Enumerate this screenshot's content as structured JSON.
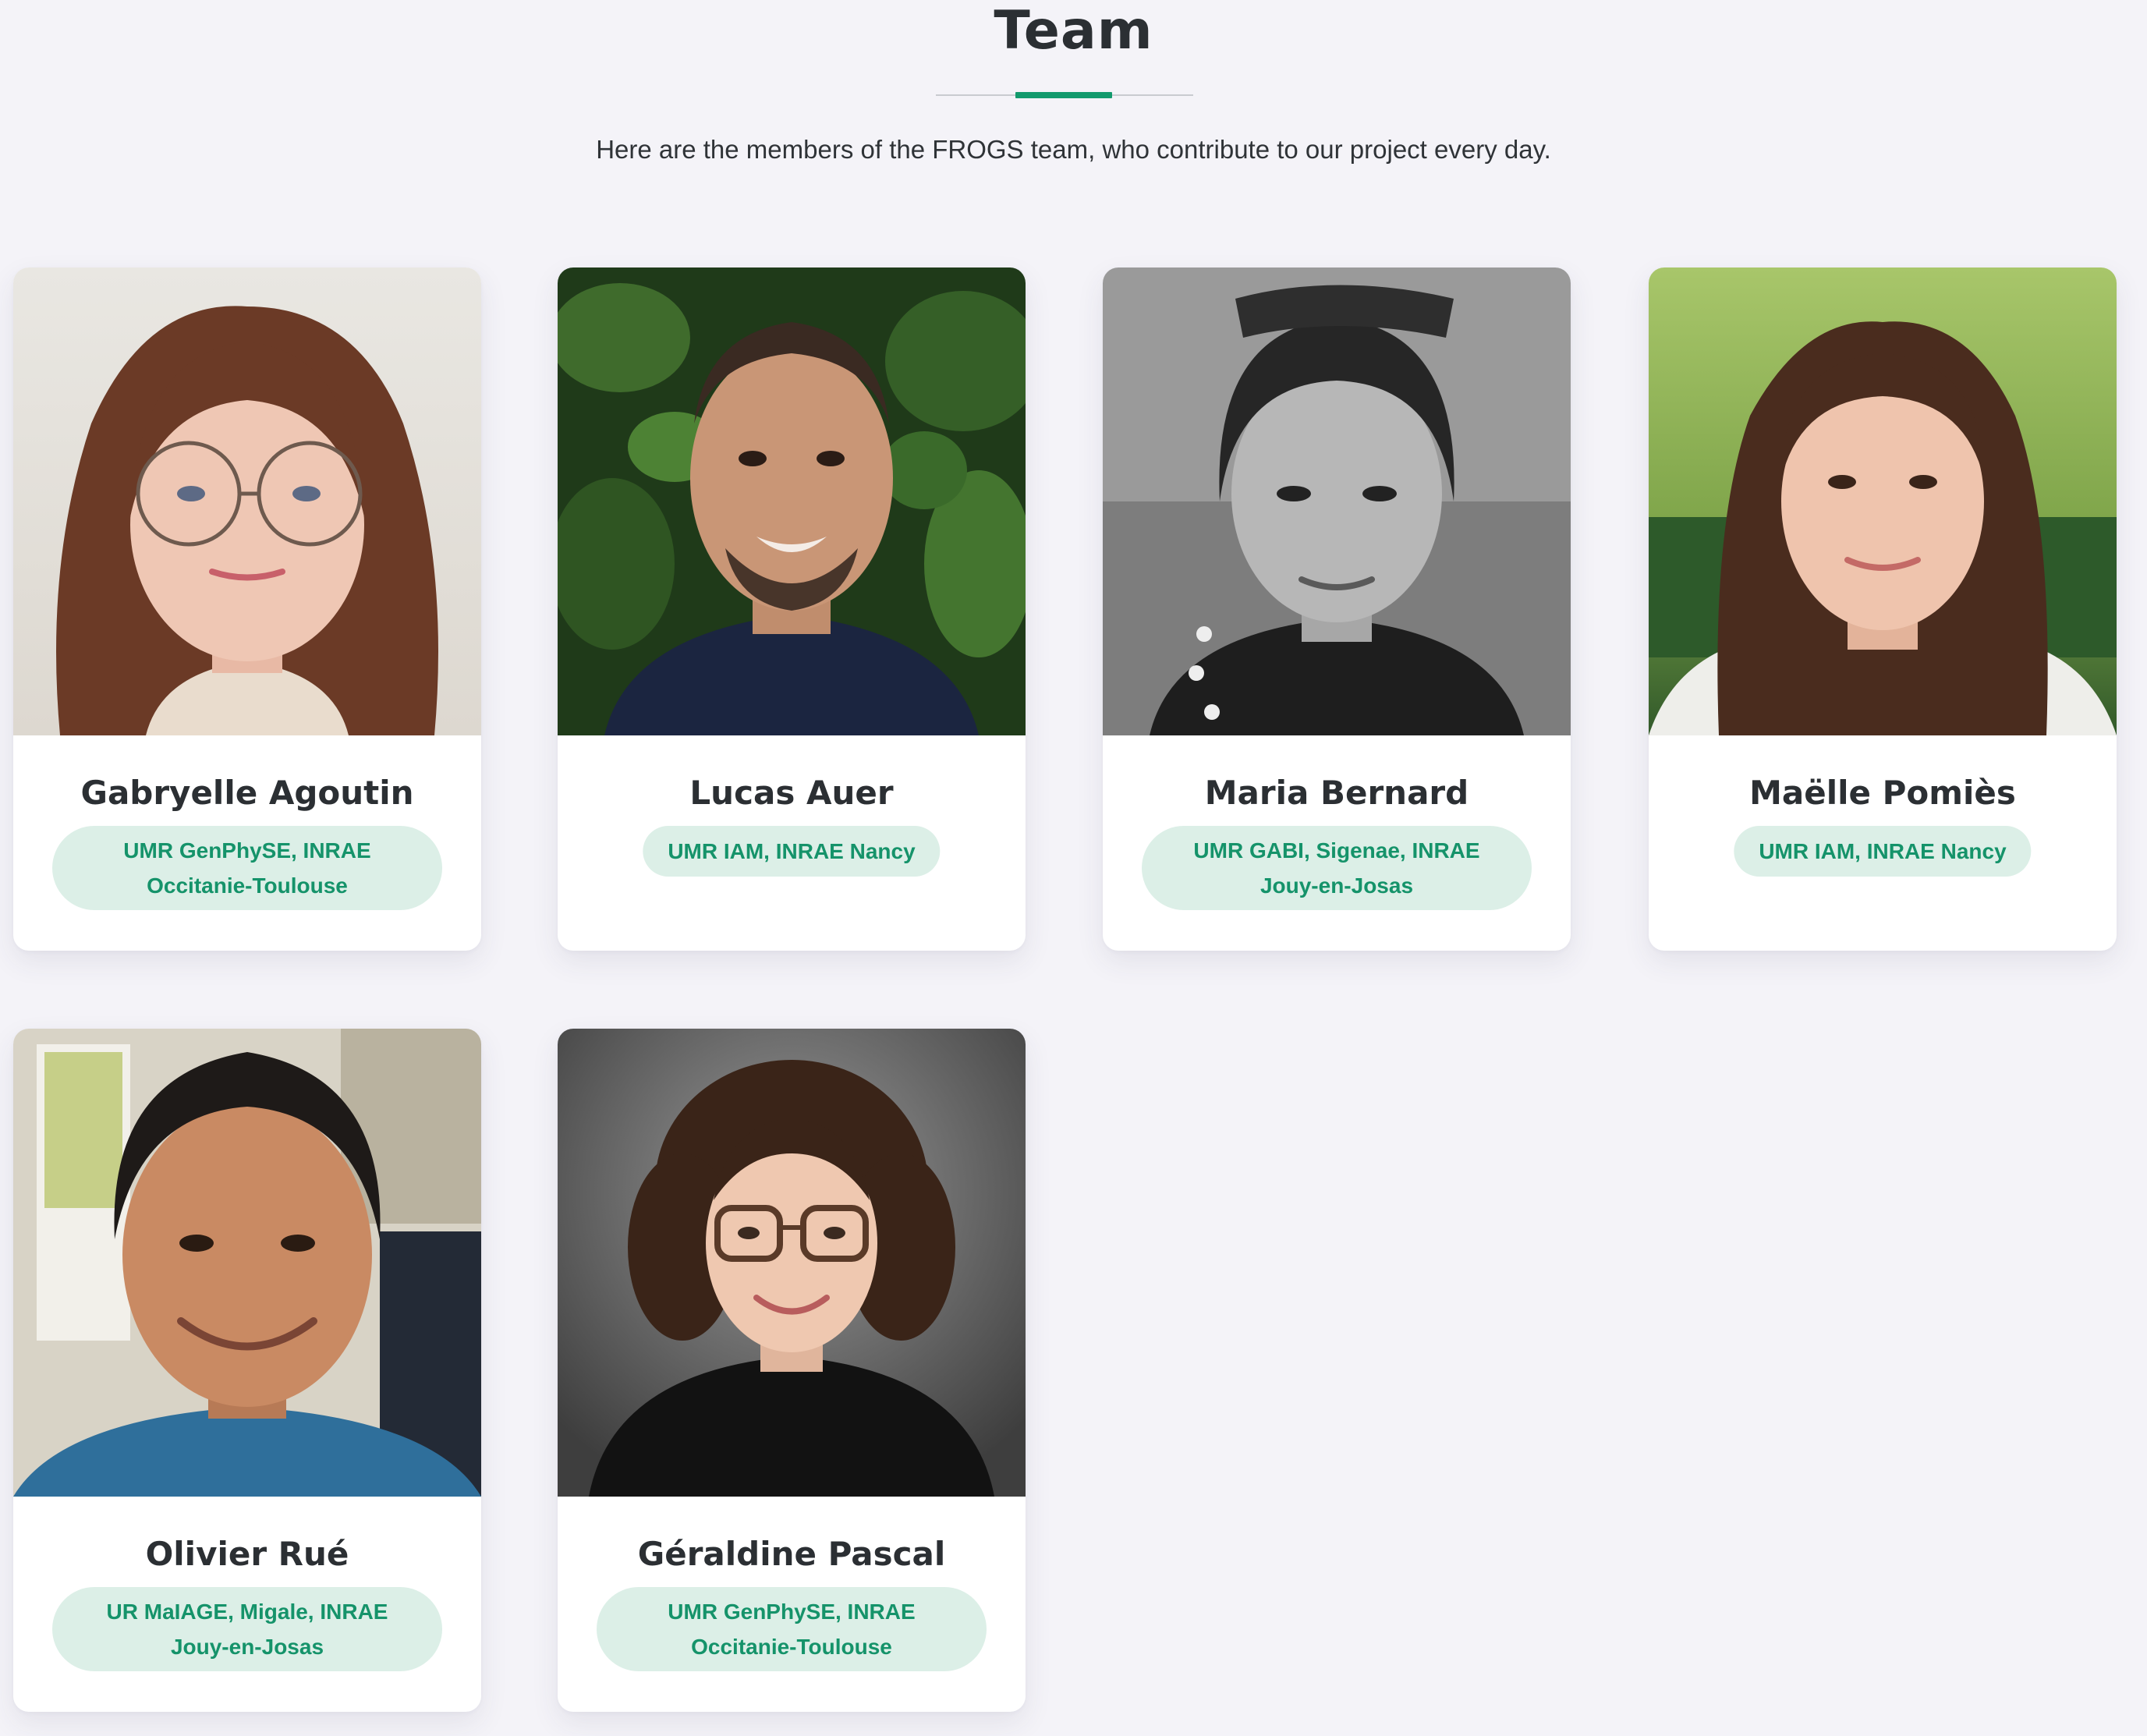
{
  "section": {
    "title": "Team",
    "subtitle": "Here are the members of the FROGS team, who contribute to our project every day."
  },
  "colors": {
    "accent": "#139a6d",
    "badge_background": "#dcefe7",
    "badge_text": "#15936a",
    "page_background": "#f4f3f8"
  },
  "members": [
    {
      "name": "Gabryelle Agoutin",
      "affiliation": "UMR GenPhySE, INRAE Occitanie-Toulouse",
      "photo": "portrait-photo"
    },
    {
      "name": "Lucas Auer",
      "affiliation": "UMR IAM, INRAE Nancy",
      "photo": "portrait-photo"
    },
    {
      "name": "Maria Bernard",
      "affiliation": "UMR GABI, Sigenae, INRAE Jouy-en-Josas",
      "photo": "portrait-photo"
    },
    {
      "name": "Maëlle Pomiès",
      "affiliation": "UMR IAM, INRAE Nancy",
      "photo": "portrait-photo"
    },
    {
      "name": "Olivier Rué",
      "affiliation": "UR MaIAGE, Migale, INRAE Jouy-en-Josas",
      "photo": "portrait-photo"
    },
    {
      "name": "Géraldine Pascal",
      "affiliation": "UMR GenPhySE, INRAE Occitanie-Toulouse",
      "photo": "portrait-photo"
    }
  ]
}
